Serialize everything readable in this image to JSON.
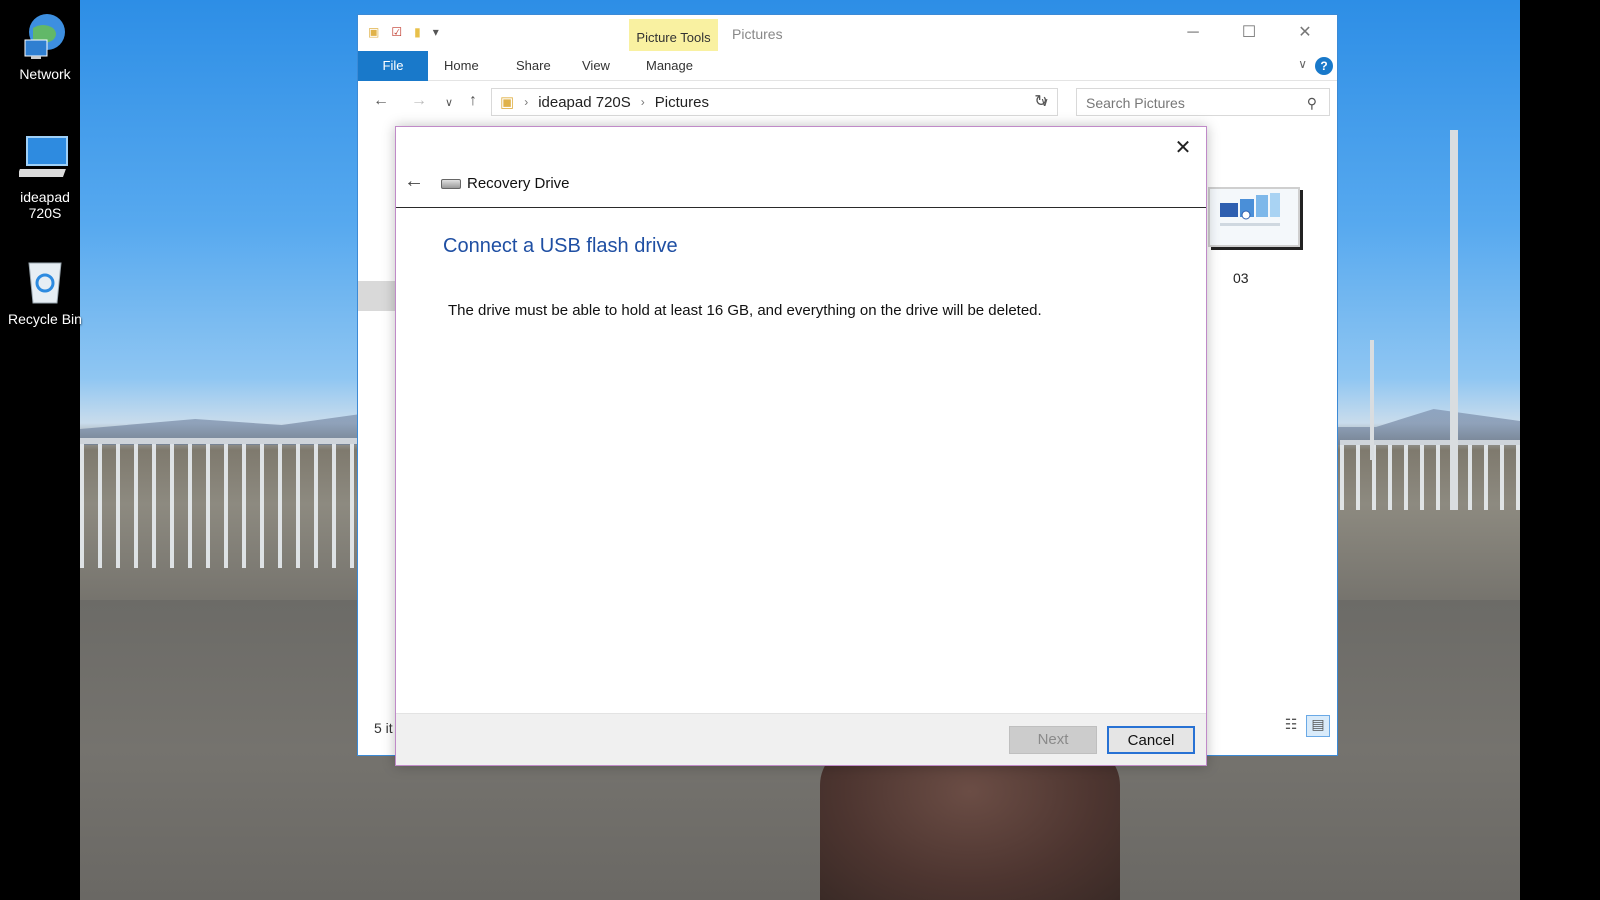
{
  "desktop": {
    "icons": [
      {
        "label": "Network",
        "icon": "network-globe-icon"
      },
      {
        "label": "ideapad 720S",
        "icon": "computer-icon"
      },
      {
        "label": "Recycle Bin",
        "icon": "recycle-bin-icon"
      }
    ]
  },
  "explorer": {
    "context_tab": "Picture Tools",
    "title": "Pictures",
    "ribbon_tabs": [
      "File",
      "Home",
      "Share",
      "View",
      "Manage"
    ],
    "address": [
      "ideapad 720S",
      "Pictures"
    ],
    "search_placeholder": "Search Pictures",
    "thumbnail_label": "03",
    "status_text": "5 it",
    "accent_color": "#1979ca"
  },
  "dialog": {
    "title": "Recovery Drive",
    "heading": "Connect a USB flash drive",
    "body": "The drive must be able to hold at least 16 GB, and everything on the drive will be deleted.",
    "next_label": "Next",
    "cancel_label": "Cancel",
    "heading_color": "#1f4fa3"
  }
}
